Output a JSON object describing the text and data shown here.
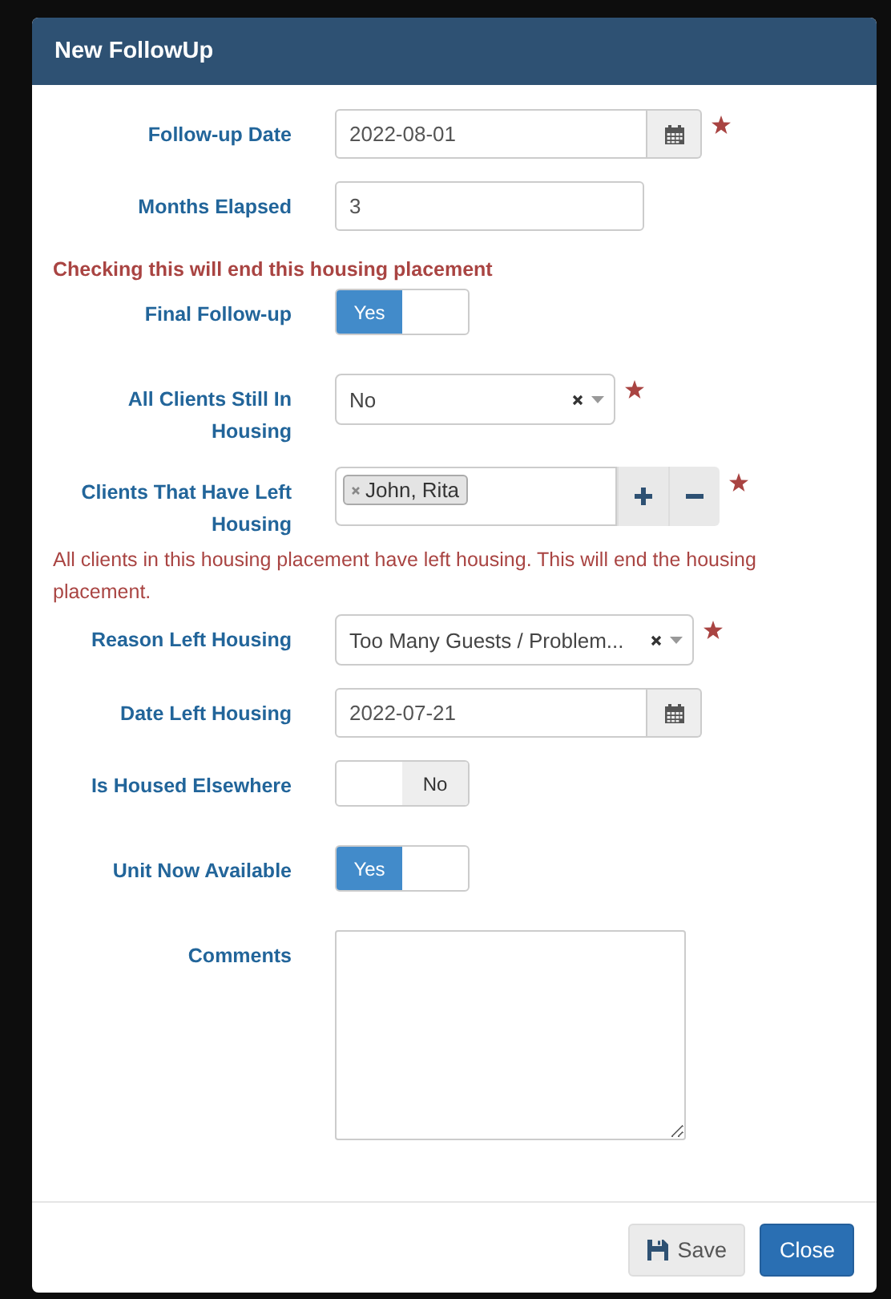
{
  "dialog": {
    "title": "New FollowUp"
  },
  "fields": [
    {
      "kind": "date",
      "label": "Follow-up Date",
      "value": "2022-08-01",
      "required": true
    },
    {
      "kind": "text",
      "label": "Months Elapsed",
      "value": "3",
      "required": false
    },
    {
      "kind": "message",
      "text": "Checking this will end this housing placement",
      "emphasis": true
    },
    {
      "kind": "toggle",
      "label": "Final Follow-up",
      "state_text": "Yes",
      "on": true
    },
    {
      "kind": "select",
      "label": "All Clients Still In Housing",
      "value": "No",
      "required": true
    },
    {
      "kind": "multiselect",
      "label": "Clients That Have Left Housing",
      "tags": [
        "John, Rita"
      ],
      "required": true
    },
    {
      "kind": "message",
      "text": "All clients in this housing placement have left housing. This will end the housing placement.",
      "emphasis": false
    },
    {
      "kind": "select",
      "label": "Reason Left Housing",
      "value": "Too Many Guests / Problem...",
      "required": true
    },
    {
      "kind": "date",
      "label": "Date Left Housing",
      "value": "2022-07-21",
      "required": false
    },
    {
      "kind": "toggle",
      "label": "Is Housed Elsewhere",
      "state_text": "No",
      "on": false
    },
    {
      "kind": "toggle",
      "label": "Unit Now Available",
      "state_text": "Yes",
      "on": true
    },
    {
      "kind": "textarea",
      "label": "Comments"
    }
  ],
  "buttons": [
    {
      "label": "Save",
      "kind": "save"
    },
    {
      "label": "Close",
      "kind": "primary"
    }
  ]
}
